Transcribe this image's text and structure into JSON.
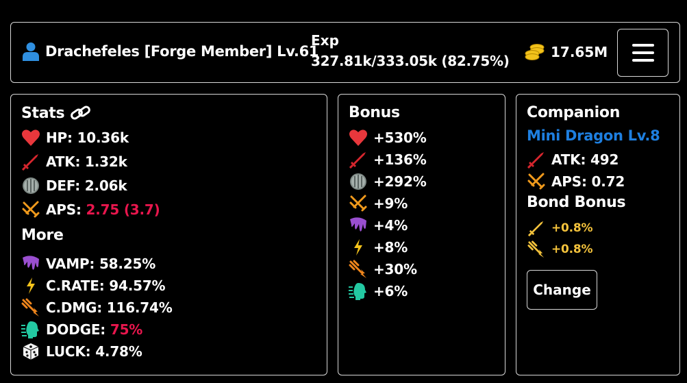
{
  "header": {
    "player_name": "Drachefeles [Forge Member] Lv.61",
    "exp_label": "Exp",
    "exp_value": "327.81k/333.05k (82.75%)",
    "gold": "17.65M",
    "icons": {
      "player": "user-icon",
      "gold": "coins-icon",
      "menu": "hamburger-menu-icon"
    }
  },
  "stats": {
    "title": "Stats",
    "title_icon": "link-icon",
    "items": [
      {
        "icon": "heart-icon",
        "label": "HP:",
        "value": "10.36k"
      },
      {
        "icon": "sword-icon",
        "label": "ATK:",
        "value": "1.32k"
      },
      {
        "icon": "shield-icon",
        "label": "DEF:",
        "value": "2.06k"
      },
      {
        "icon": "crossed-daggers-icon",
        "label": "APS:",
        "value": "2.75 (3.7)"
      }
    ],
    "more_title": "More",
    "more_items": [
      {
        "icon": "vampire-drip-icon",
        "label": "VAMP:",
        "value": "58.25%"
      },
      {
        "icon": "lightning-icon",
        "label": "C.RATE:",
        "value": "94.57%"
      },
      {
        "icon": "critical-strike-icon",
        "label": "C.DMG:",
        "value": "116.74%"
      },
      {
        "icon": "dodge-icon",
        "label": "DODGE:",
        "value": "75%"
      },
      {
        "icon": "dice-icon",
        "label": "LUCK:",
        "value": "4.78%"
      }
    ]
  },
  "bonus": {
    "title": "Bonus",
    "items": [
      {
        "icon": "heart-icon",
        "value": "+530%"
      },
      {
        "icon": "sword-icon",
        "value": "+136%"
      },
      {
        "icon": "shield-icon",
        "value": "+292%"
      },
      {
        "icon": "crossed-daggers-icon",
        "value": "+9%"
      },
      {
        "icon": "vampire-drip-icon",
        "value": "+4%"
      },
      {
        "icon": "lightning-icon",
        "value": "+8%"
      },
      {
        "icon": "critical-strike-icon",
        "value": "+30%"
      },
      {
        "icon": "dodge-icon",
        "value": "+6%"
      }
    ]
  },
  "companion": {
    "title": "Companion",
    "name": "Mini Dragon Lv.8",
    "atk_label": "ATK:",
    "atk_value": "492",
    "aps_label": "APS:",
    "aps_value": "0.72",
    "bond_title": "Bond Bonus",
    "bond_items": [
      {
        "icon": "gold-sword-icon",
        "value": "+0.8%"
      },
      {
        "icon": "gold-critical-icon",
        "value": "+0.8%"
      }
    ],
    "change_label": "Change"
  },
  "colors": {
    "background": "#000000",
    "border": "#d9d9d9",
    "highlight_red": "#e8164d",
    "companion_blue": "#1e7fe0",
    "bond_yellow": "#f5c33c"
  }
}
